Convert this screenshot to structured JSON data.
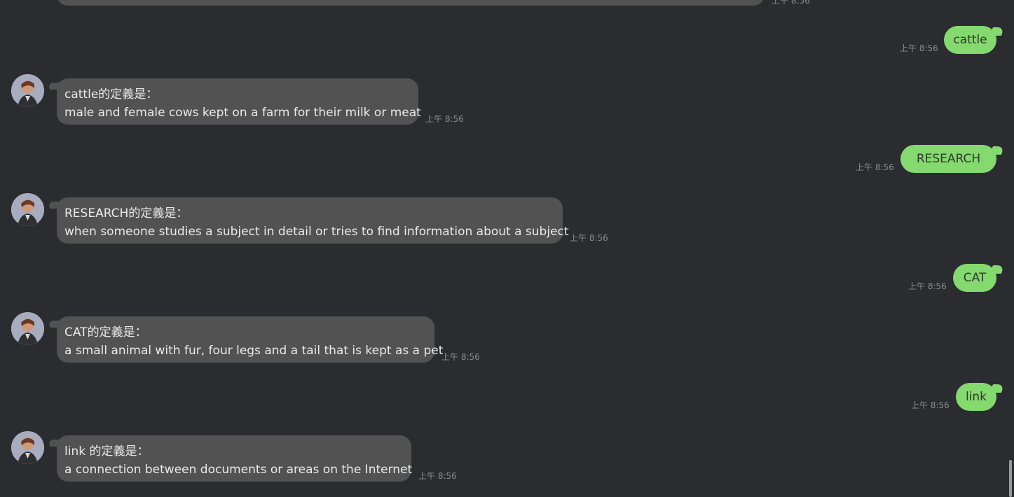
{
  "partial_top_message": {
    "time": "上午 8:56"
  },
  "messages": [
    {
      "type": "out",
      "text": "cattle",
      "time": "上午 8:56"
    },
    {
      "type": "in",
      "line1": "cattle的定義是：",
      "line2": "male and female cows kept on a farm for their milk or meat",
      "time": "上午 8:56"
    },
    {
      "type": "out",
      "text": "   RESEARCH",
      "time": "上午 8:56"
    },
    {
      "type": "in",
      "line1": "    RESEARCH的定義是：",
      "line2": "when someone studies a subject in detail or tries to find information about a subject",
      "time": "上午 8:56"
    },
    {
      "type": "out",
      "text": "CAT",
      "time": "上午 8:56"
    },
    {
      "type": "in",
      "line1": "CAT的定義是：",
      "line2": "a small animal with fur, four legs and a tail that is kept as a pet",
      "time": "上午 8:56"
    },
    {
      "type": "out",
      "text": "link",
      "time": "上午 8:56"
    },
    {
      "type": "in",
      "line1": "link         的定義是：",
      "line2": "a connection between documents or areas on the Internet",
      "time": "上午 8:56"
    }
  ],
  "colors": {
    "background": "#2b2c2f",
    "incoming_bubble": "#525252",
    "outgoing_bubble": "#84d96f",
    "timestamp": "#8b8b8b"
  },
  "icons": {
    "avatar": "profile-photo"
  }
}
